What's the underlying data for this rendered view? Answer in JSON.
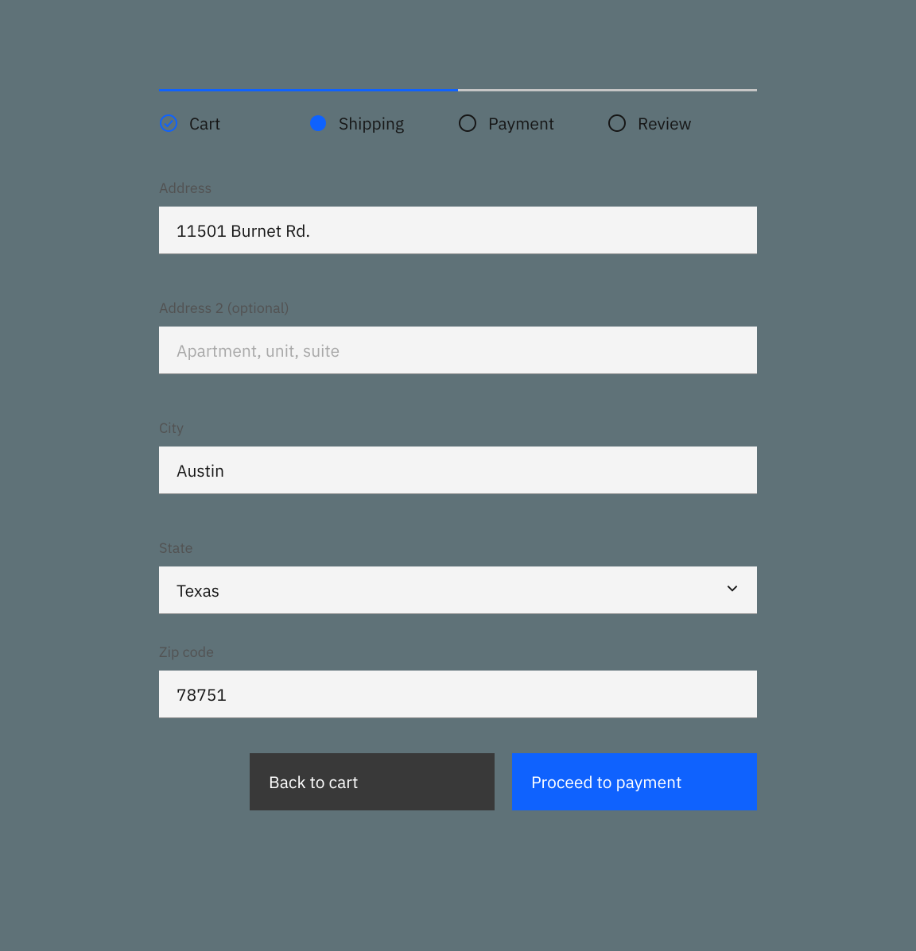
{
  "progress": {
    "percent": 50,
    "steps": [
      {
        "label": "Cart",
        "state": "complete"
      },
      {
        "label": "Shipping",
        "state": "current"
      },
      {
        "label": "Payment",
        "state": "upcoming"
      },
      {
        "label": "Review",
        "state": "upcoming"
      }
    ]
  },
  "fields": {
    "address": {
      "label": "Address",
      "value": "11501 Burnet Rd.",
      "placeholder": ""
    },
    "address2": {
      "label": "Address 2 (optional)",
      "value": "",
      "placeholder": "Apartment, unit, suite"
    },
    "city": {
      "label": "City",
      "value": "Austin",
      "placeholder": ""
    },
    "state": {
      "label": "State",
      "value": "Texas"
    },
    "zip": {
      "label": "Zip code",
      "value": "78751",
      "placeholder": ""
    }
  },
  "buttons": {
    "back": "Back to cart",
    "proceed": "Proceed to payment"
  },
  "colors": {
    "accent": "#0f62fe",
    "secondary_button": "#393939",
    "field_bg": "#f4f4f4"
  }
}
